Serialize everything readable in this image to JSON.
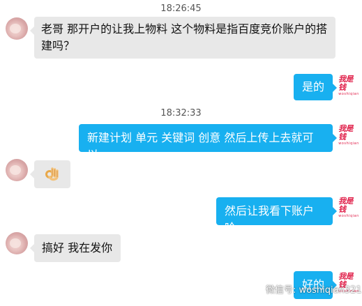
{
  "messages": [
    {
      "type": "time",
      "text": "18:26:45"
    },
    {
      "type": "in",
      "text": "老哥 那开户的让我上物料 这个物料是指百度竞价账户的搭建吗？"
    },
    {
      "type": "out",
      "text": "是的"
    },
    {
      "type": "time",
      "text": "18:32:33"
    },
    {
      "type": "out",
      "text": "新建计划 单元 关键词 创意 然后上传上去就可以"
    },
    {
      "type": "in",
      "emoji": "ok-hand-emoji"
    },
    {
      "type": "out",
      "text": "然后让我看下账户哈"
    },
    {
      "type": "in",
      "text": "搞好 我在发你"
    },
    {
      "type": "out",
      "text": "好的"
    }
  ],
  "chat": {
    "time1": "18:26:45",
    "msg1_line1": "老哥 那开户的让我上物料 这个物料是指百度竞价账户的搭",
    "msg1_line2": "建吗？",
    "msg2": "是的",
    "time2": "18:32:33",
    "msg3": "新建计划 单元 关键词 创意 然后上传上去就可以",
    "msg4_emoji": "ok-hand-emoji",
    "msg5": "然后让我看下账户哈",
    "msg6": "搞好 我在发你",
    "msg7": "好的"
  },
  "sender_logo": {
    "main": "我是钱",
    "sub": "woshiqian"
  },
  "watermark": {
    "text": "微信号: woshiqian321",
    "icon": "wechat-icon"
  },
  "colors": {
    "out_bubble": "#18b0f0",
    "in_bubble": "#e8e8e8",
    "logo": "#e0204a"
  }
}
